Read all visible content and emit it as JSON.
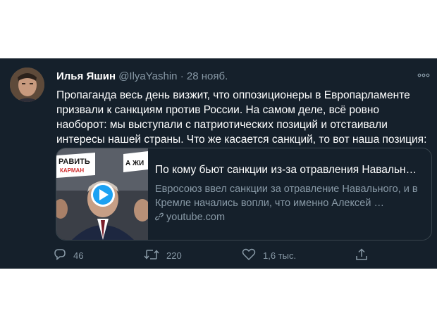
{
  "tweet": {
    "author_name": "Илья Яшин",
    "handle": "@IlyaYashin",
    "separator": "·",
    "date": "28 нояб.",
    "more_icon": "more-dots-icon",
    "text": "Пропаганда весь день визжит, что оппозиционеры в Европарламенте призвали к санкциям против России. На самом деле, всё ровно наоборот: мы выступали с патриотических позиций и отстаивали интересы нашей страны. Что же касается санкций, то вот наша позиция:",
    "card": {
      "title": "По кому бьют санкции из-за отравления Навальн…",
      "description": "Евросоюз ввел санкции за отравление Навального, и в Кремле начались вопли, что именно Алексей …",
      "domain": "youtube.com",
      "thumb_text_left": "РАВИТЬ",
      "thumb_text_left2": "КАРМАН",
      "thumb_text_right": "А ЖИ"
    },
    "actions": {
      "replies": "46",
      "retweets": "220",
      "likes": "1,6 тыс."
    },
    "colors": {
      "background": "#15202b",
      "secondary": "#8899a6",
      "play_button": "#1da1f2"
    }
  }
}
